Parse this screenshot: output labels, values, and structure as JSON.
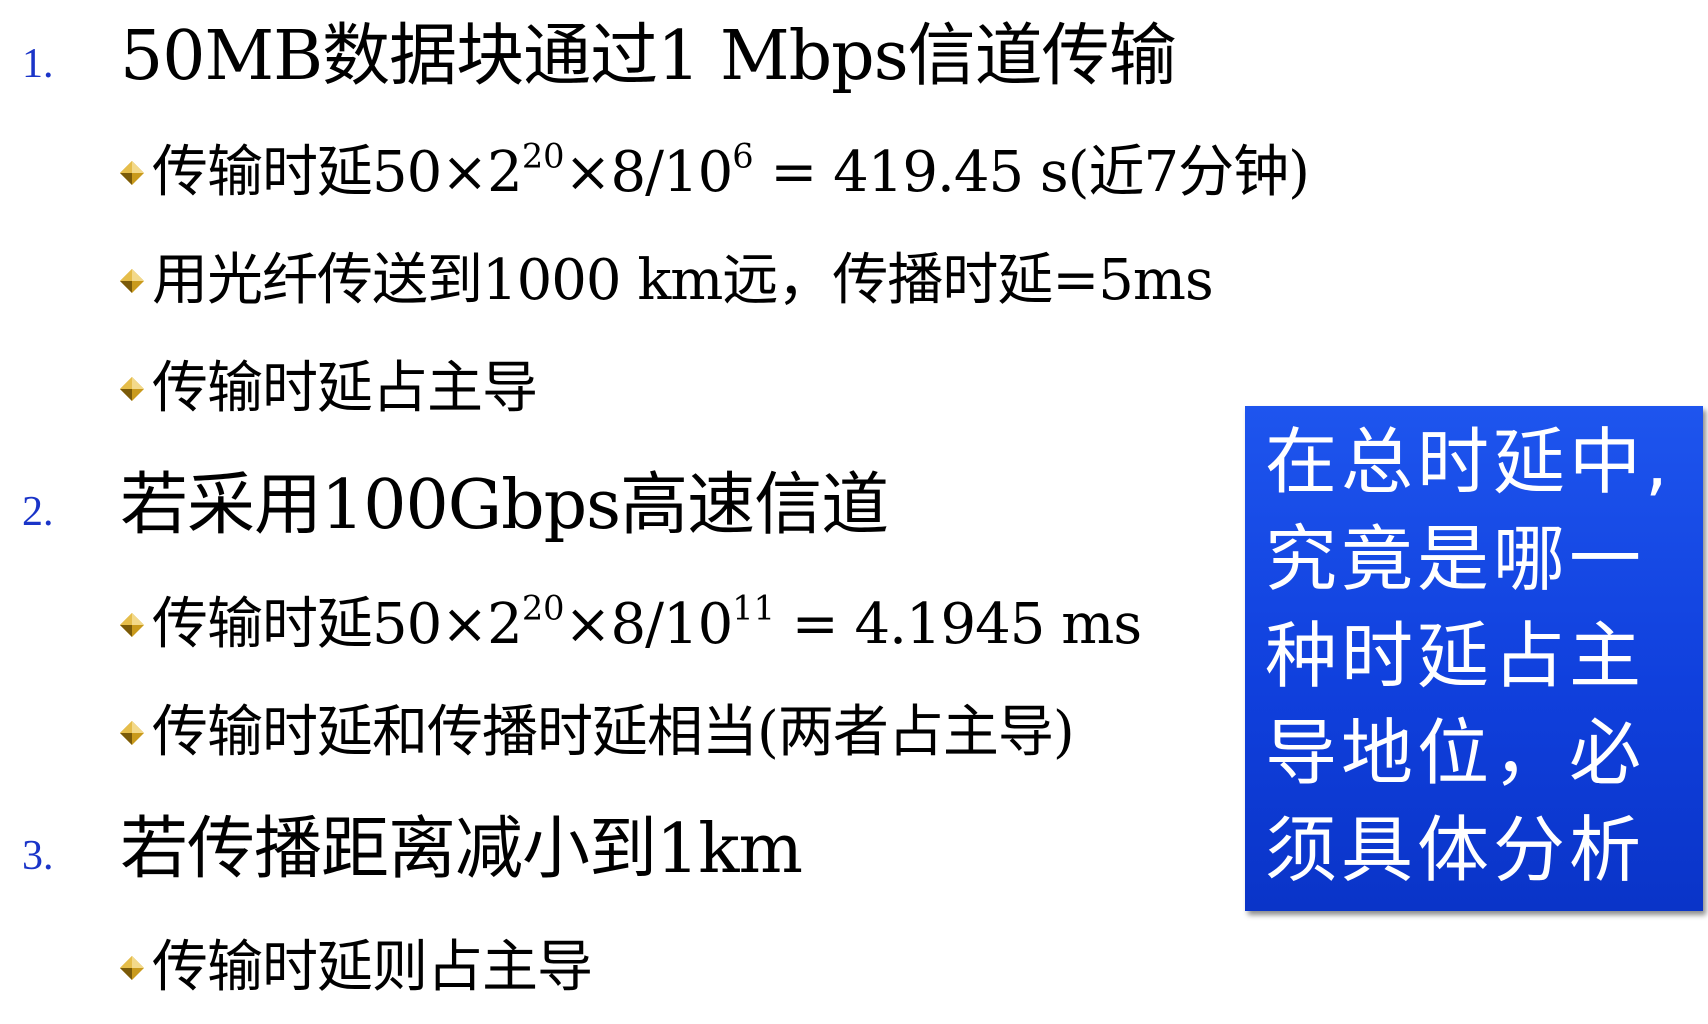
{
  "items": [
    {
      "number": "1.",
      "heading": "50MB数据块通过1 Mbps信道传输",
      "bullets": [
        {
          "pre": "传输时延50×2",
          "sup1": "20",
          "mid": "×8/10",
          "sup2": "6",
          "post": " = 419.45 s(近7分钟)"
        },
        {
          "text": "用光纤传送到1000 km远，传播时延=5ms"
        },
        {
          "text": "传输时延占主导"
        }
      ]
    },
    {
      "number": "2.",
      "heading": "若采用100Gbps高速信道",
      "bullets": [
        {
          "pre": "传输时延50×2",
          "sup1": "20",
          "mid": "×8/10",
          "sup2": "11",
          "post": " = 4.1945 ms"
        },
        {
          "text": "传输时延和传播时延相当(两者占主导)"
        }
      ]
    },
    {
      "number": "3.",
      "heading": "若传播距离减小到1km",
      "bullets": [
        {
          "text": "传输时延则占主导"
        }
      ]
    }
  ],
  "callout": {
    "lines": [
      "在总时延中,",
      "究竟是哪一",
      "种时延占主",
      "导地位，必",
      "须具体分析"
    ]
  },
  "colors": {
    "number": "#1a34c8",
    "callout_bg": "#1545e6",
    "callout_text": "#ffffff",
    "bullet_gold": "#b58a12"
  },
  "icons": {
    "bullet": "gold-diamond-bullet-icon"
  }
}
